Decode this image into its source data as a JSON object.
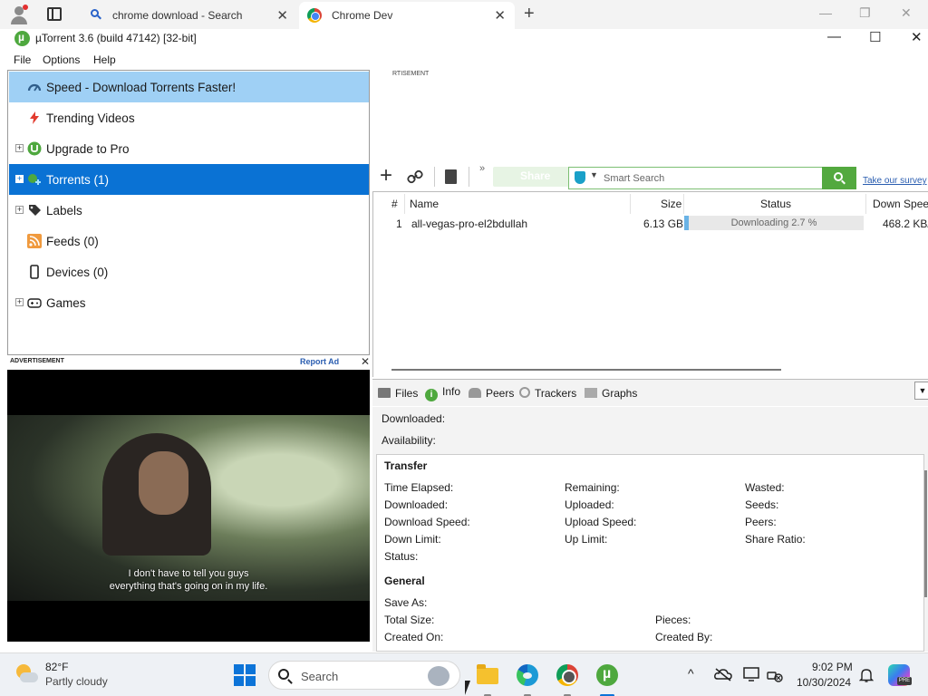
{
  "browser": {
    "tabs": [
      {
        "label": "chrome download - Search",
        "close": "✕"
      },
      {
        "label": "Chrome Dev",
        "close": "✕"
      }
    ],
    "new_tab": "+",
    "controls": {
      "minimize": "—",
      "restore": "❐",
      "close": "✕"
    }
  },
  "window": {
    "title": "µTorrent 3.6  (build 47142) [32-bit]",
    "controls": {
      "minimize": "—",
      "maximize": "☐",
      "close": "✕"
    }
  },
  "menu": [
    "File",
    "Options",
    "Help"
  ],
  "sidebar": {
    "items": [
      {
        "label": "Speed - Download Torrents Faster!",
        "icon": "speed-icon",
        "state": "highlighted"
      },
      {
        "label": "Trending Videos",
        "icon": "bolt-icon"
      },
      {
        "label": "Upgrade to Pro",
        "icon": "utorrent-icon",
        "expander": "+"
      },
      {
        "label": "Torrents (1)",
        "icon": "torrents-icon",
        "expander": "+",
        "state": "selected"
      },
      {
        "label": "Labels",
        "icon": "tag-icon",
        "expander": "+"
      },
      {
        "label": "Feeds (0)",
        "icon": "rss-icon"
      },
      {
        "label": "Devices (0)",
        "icon": "device-icon"
      },
      {
        "label": "Games",
        "icon": "gamepad-icon",
        "expander": "+"
      }
    ]
  },
  "advertisement": {
    "label": "ADVERTISEMENT",
    "report": "Report Ad",
    "close": "✕",
    "subtitle_line1": "I don't have to tell you guys",
    "subtitle_line2": "everything that's going on in my life.",
    "top_label": "RTISEMENT"
  },
  "toolbar": {
    "add": "+",
    "link": "🔗",
    "more": "»",
    "share": "Share",
    "search_placeholder": "Smart Search",
    "survey": "Take our survey"
  },
  "torrent_table": {
    "columns": [
      "#",
      "Name",
      "Size",
      "Status",
      "Down Speed"
    ],
    "rows": [
      {
        "num": "1",
        "name": "all-vegas-pro-el2bdullah",
        "size": "6.13 GB",
        "status": "Downloading 2.7 %",
        "progress": 0.027,
        "down_speed": "468.2 KB/s"
      }
    ]
  },
  "detail_tabs": [
    "Files",
    "Info",
    "Peers",
    "Trackers",
    "Graphs"
  ],
  "info": {
    "downloaded": "Downloaded:",
    "availability": "Availability:",
    "transfer_title": "Transfer",
    "transfer_col1": [
      "Time Elapsed:",
      "Downloaded:",
      "Download Speed:",
      "Down Limit:",
      "Status:"
    ],
    "transfer_col2": [
      "Remaining:",
      "Uploaded:",
      "Upload Speed:",
      "Up Limit:"
    ],
    "transfer_col3": [
      "Wasted:",
      "Seeds:",
      "Peers:",
      "Share Ratio:"
    ],
    "general_title": "General",
    "general_col1": [
      "Save As:",
      "Total Size:",
      "Created On:"
    ],
    "general_col2": [
      "Pieces:",
      "Created By:"
    ]
  },
  "taskbar": {
    "temp": "82°F",
    "condition": "Partly cloudy",
    "search": "Search",
    "time": "9:02 PM",
    "date": "10/30/2024",
    "tray_chevron": "^",
    "copilot_badge": "PRE"
  }
}
